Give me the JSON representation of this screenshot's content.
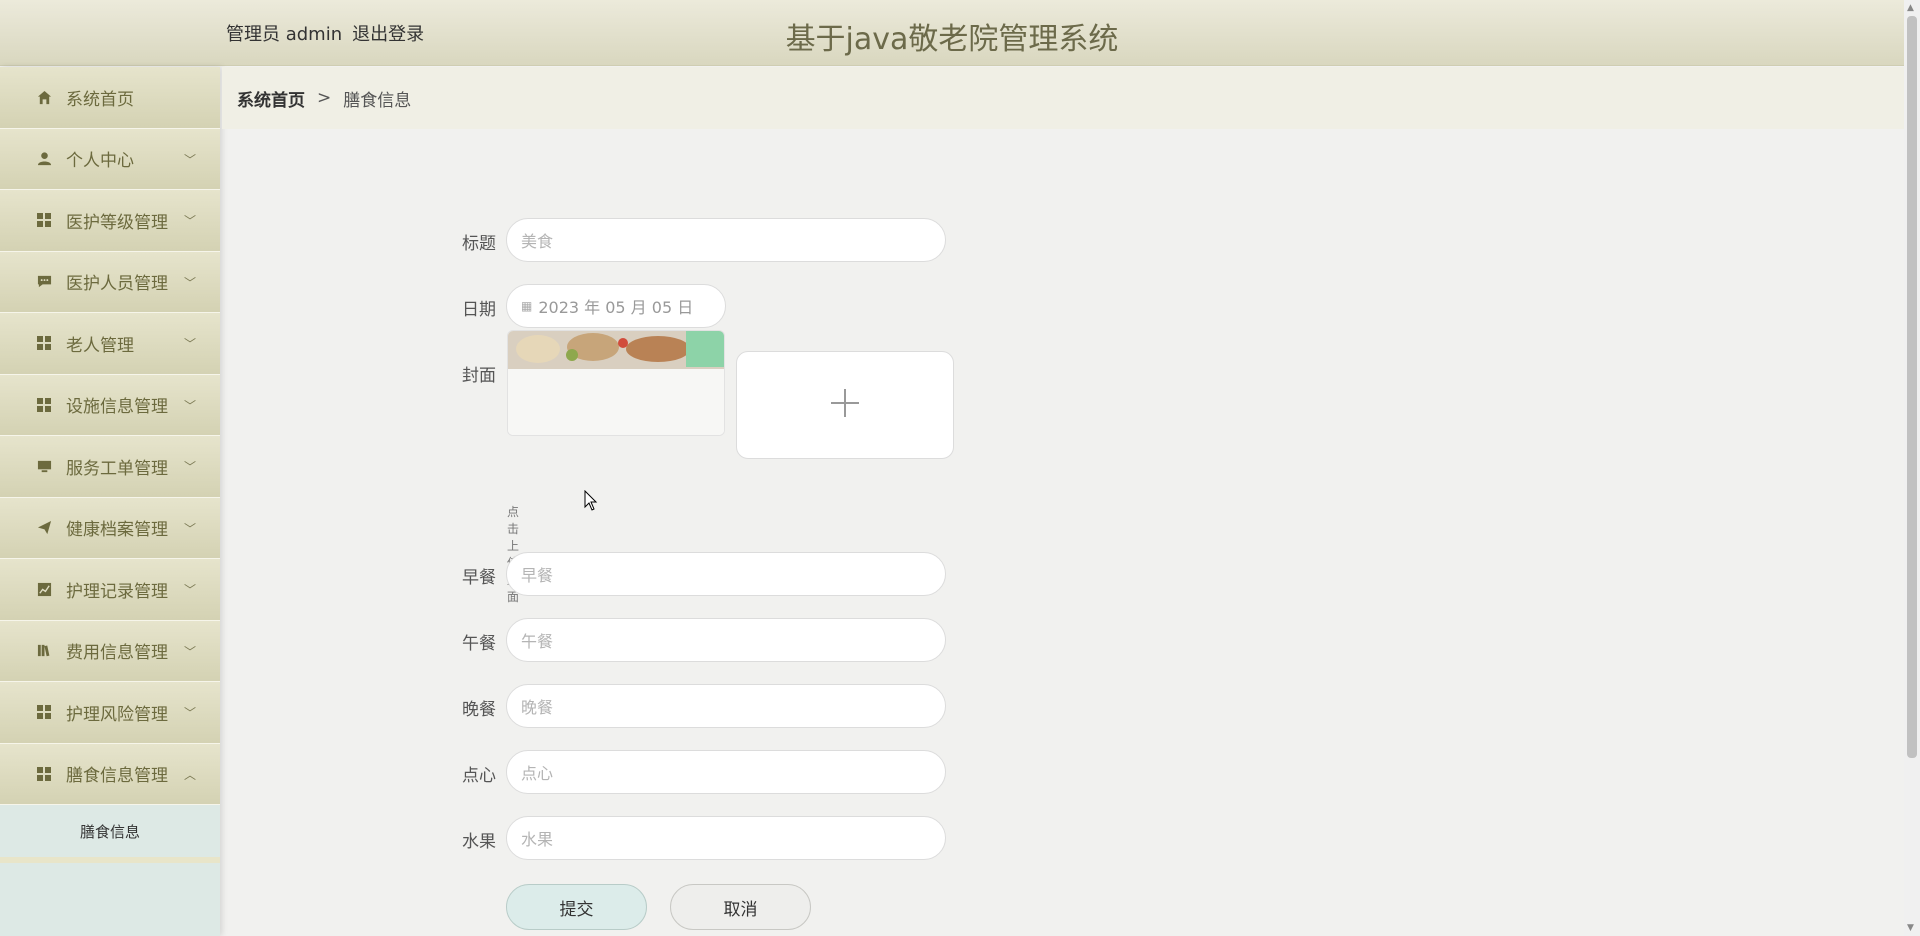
{
  "header": {
    "user_label": "管理员 admin",
    "logout_label": "退出登录",
    "app_title": "基于java敬老院管理系统"
  },
  "sidebar": {
    "items": [
      {
        "label": "系统首页",
        "icon": "home-icon"
      },
      {
        "label": "个人中心",
        "icon": "user-icon"
      },
      {
        "label": "医护等级管理",
        "icon": "grid-icon"
      },
      {
        "label": "医护人员管理",
        "icon": "chat-icon"
      },
      {
        "label": "老人管理",
        "icon": "grid-icon"
      },
      {
        "label": "设施信息管理",
        "icon": "grid-icon"
      },
      {
        "label": "服务工单管理",
        "icon": "monitor-icon"
      },
      {
        "label": "健康档案管理",
        "icon": "send-icon"
      },
      {
        "label": "护理记录管理",
        "icon": "chart-icon"
      },
      {
        "label": "费用信息管理",
        "icon": "books-icon"
      },
      {
        "label": "护理风险管理",
        "icon": "grid-icon"
      },
      {
        "label": "膳食信息管理",
        "icon": "grid-icon"
      }
    ],
    "submenu": {
      "label": "膳食信息"
    }
  },
  "breadcrumb": {
    "home": "系统首页",
    "separator": ">",
    "current": "膳食信息"
  },
  "form": {
    "title_label": "标题",
    "title_placeholder": "美食",
    "date_label": "日期",
    "date_value": "2023 年 05 月 05 日",
    "cover_label": "封面",
    "cover_hint": "点击上传封面",
    "breakfast_label": "早餐",
    "breakfast_placeholder": "早餐",
    "lunch_label": "午餐",
    "lunch_placeholder": "午餐",
    "dinner_label": "晚餐",
    "dinner_placeholder": "晚餐",
    "snack_label": "点心",
    "snack_placeholder": "点心",
    "fruit_label": "水果",
    "fruit_placeholder": "水果",
    "submit_label": "提交",
    "cancel_label": "取消"
  },
  "colors": {
    "header_bg": "#d9d7bf",
    "menu_bg": "#d4d2b3",
    "menu_text": "#6c6a3e",
    "sidebar_bg": "#dde9e5",
    "title_color": "#6c6a4a"
  }
}
